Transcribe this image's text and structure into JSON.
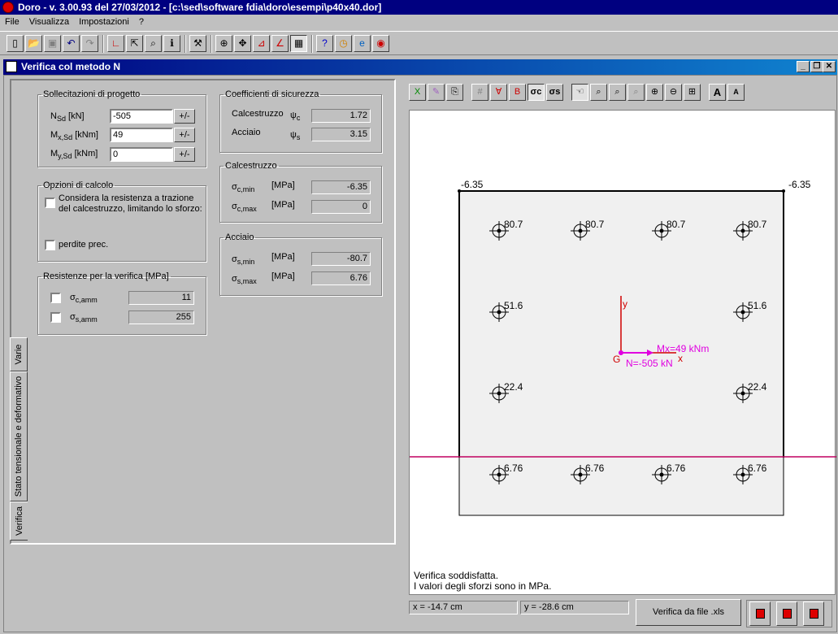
{
  "app": {
    "title": "Doro - v. 3.00.93 del 27/03/2012 - [c:\\sed\\software fdia\\doro\\esempi\\p40x40.dor]"
  },
  "menu": [
    "File",
    "Visualizza",
    "Impostazioni",
    "?"
  ],
  "toolbar_icons": [
    "new-file-icon",
    "open-file-icon",
    "save-icon",
    "undo-icon",
    "redo-icon",
    "section-icon",
    "select-icon",
    "zoom-icon",
    "info-icon",
    "tools-icon",
    "geometry-icon",
    "loads-icon",
    "verify-icon",
    "diagram-icon",
    "check-n-icon",
    "help-icon",
    "clock-icon",
    "web-icon",
    "about-icon"
  ],
  "child": {
    "title": "Verifica col metodo N"
  },
  "tabs": [
    "Varie",
    "Stato tensionale e deformativo",
    "Verifica"
  ],
  "loads": {
    "legend": "Sollecitazioni di progetto",
    "rows": [
      {
        "label": "N",
        "sub": "Sd",
        "unit": "[kN]",
        "value": "-505",
        "btn": "+/-"
      },
      {
        "label": "M",
        "sub": "x,Sd",
        "unit": "[kNm]",
        "value": "49",
        "btn": "+/-"
      },
      {
        "label": "M",
        "sub": "y,Sd",
        "unit": "[kNm]",
        "value": "0",
        "btn": "+/-"
      }
    ]
  },
  "options": {
    "legend": "Opzioni di calcolo",
    "opt1_line1": "Considera la resistenza a trazione",
    "opt1_line2": "del calcestruzzo, limitando lo sforzo:",
    "opt2": "perdite prec."
  },
  "resist": {
    "legend": "Resistenze per la verifica [MPa]",
    "rows": [
      {
        "sym": "σ",
        "sub": "c,amm",
        "value": "11"
      },
      {
        "sym": "σ",
        "sub": "s,amm",
        "value": "255"
      }
    ]
  },
  "coeff": {
    "legend": "Coefficienti di sicurezza",
    "rows": [
      {
        "label": "Calcestruzzo",
        "sym": "ψ",
        "sub": "c",
        "value": "1.72"
      },
      {
        "label": "Acciaio",
        "sym": "ψ",
        "sub": "s",
        "value": "3.15"
      }
    ]
  },
  "concrete": {
    "legend": "Calcestruzzo",
    "rows": [
      {
        "sym": "σ",
        "sub": "c,min",
        "unit": "[MPa]",
        "value": "-6.35"
      },
      {
        "sym": "σ",
        "sub": "c,max",
        "unit": "[MPa]",
        "value": "0"
      }
    ]
  },
  "steel": {
    "legend": "Acciaio",
    "rows": [
      {
        "sym": "σ",
        "sub": "s,min",
        "unit": "[MPa]",
        "value": "-80.7"
      },
      {
        "sym": "σ",
        "sub": "s,max",
        "unit": "[MPa]",
        "value": "6.76"
      }
    ]
  },
  "drawing": {
    "corner_left": "-6.35",
    "corner_right": "-6.35",
    "bars": [
      {
        "label": "80.7"
      },
      {
        "label": "80.7"
      },
      {
        "label": "80.7"
      },
      {
        "label": "80.7"
      },
      {
        "label": "51.6"
      },
      {
        "label": "51.6"
      },
      {
        "label": "22.4"
      },
      {
        "label": "22.4"
      },
      {
        "label": "6.76"
      },
      {
        "label": "6.76"
      },
      {
        "label": "6.76"
      },
      {
        "label": "6.76"
      }
    ],
    "axis_y": "y",
    "axis_x": "x",
    "origin": "G",
    "moment": "Mx=49 kNm",
    "axial": "N=-505 kN",
    "message_line1": "Verifica soddisfatta.",
    "message_line2": "I valori degli sforzi sono in MPa."
  },
  "status": {
    "x": "x = -14.7 cm",
    "y": "y = -28.6 cm"
  },
  "verify_file_button": "Verifica da file .xls",
  "colors": {
    "title_bar": "#000080",
    "neutral_axis": "#c00060",
    "loads_arrow": "#e000e0",
    "axes": "#d00000",
    "section_fill": "#f0f0f0"
  }
}
